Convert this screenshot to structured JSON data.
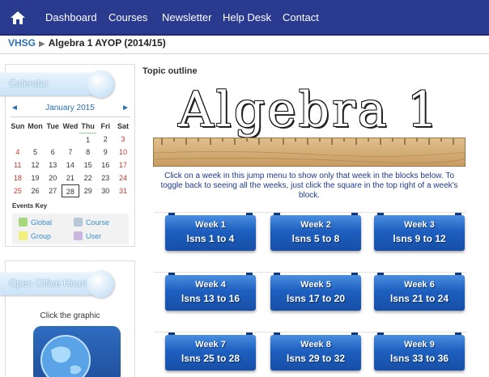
{
  "nav": {
    "home_icon": "home-icon",
    "items": [
      "Dashboard",
      "Courses",
      "Newsletter",
      "Help Desk",
      "Contact"
    ]
  },
  "breadcrumb": {
    "root": "VHSG",
    "separator": "▶",
    "current": "Algebra 1 AYOP (2014/15)"
  },
  "calendar": {
    "title": "Calendar",
    "month": "January 2015",
    "prev": "◄",
    "next": "►",
    "weekdays": [
      "Sun",
      "Mon",
      "Tue",
      "Wed",
      "Thu",
      "Fri",
      "Sat"
    ],
    "rows": [
      [
        "",
        "",
        "",
        "",
        "1",
        "2",
        "3"
      ],
      [
        "4",
        "5",
        "6",
        "7",
        "8",
        "9",
        "10"
      ],
      [
        "11",
        "12",
        "13",
        "14",
        "15",
        "16",
        "17"
      ],
      [
        "18",
        "19",
        "20",
        "21",
        "22",
        "23",
        "24"
      ],
      [
        "25",
        "26",
        "27",
        "28",
        "29",
        "30",
        "31"
      ]
    ],
    "today": "28",
    "events_key_label": "Events Key",
    "events_key": [
      {
        "label": "Global",
        "color": "#a8d67a"
      },
      {
        "label": "Course",
        "color": "#b7c9d9"
      },
      {
        "label": "Group",
        "color": "#f2f07a"
      },
      {
        "label": "User",
        "color": "#c9b7e0"
      }
    ]
  },
  "office_hours": {
    "title": "Open Office Hours",
    "caption": "Click the graphic"
  },
  "main": {
    "topic_title": "Topic outline",
    "banner_text": "Algebra 1",
    "instructions": "Click on a week in this jump menu to show only that week in the blocks below. To toggle back to seeing all the weeks, just click the square in the top right of a week's block.",
    "weeks": [
      {
        "week": "Week 1",
        "lessons": "lsns 1 to 4"
      },
      {
        "week": "Week 2",
        "lessons": "lsns 5 to 8"
      },
      {
        "week": "Week 3",
        "lessons": "lsns 9 to 12"
      },
      {
        "week": "Week 4",
        "lessons": "lsns 13 to 16"
      },
      {
        "week": "Week 5",
        "lessons": "lsns 17 to 20"
      },
      {
        "week": "Week 6",
        "lessons": "lsns 21 to 24"
      },
      {
        "week": "Week 7",
        "lessons": "lsns 25 to 28"
      },
      {
        "week": "Week 8",
        "lessons": "lsns 29 to 32"
      },
      {
        "week": "Week 9",
        "lessons": "lsns 33 to 36"
      }
    ]
  },
  "colors": {
    "nav_bg": "#2a3a8f",
    "link_blue": "#2a6fb0",
    "weekend_red": "#c0392b",
    "week_button": "#1d5fbf"
  }
}
